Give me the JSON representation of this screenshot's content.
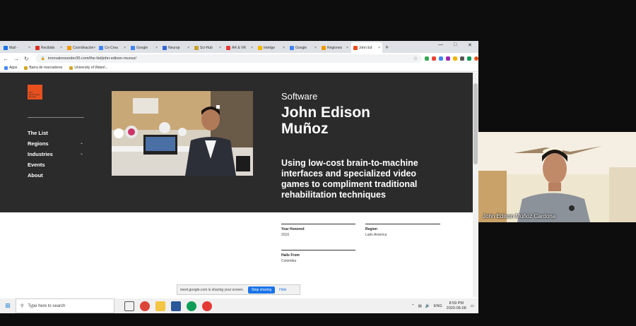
{
  "browser": {
    "tabs": [
      {
        "label": "Mail -",
        "color": "#1a73e8"
      },
      {
        "label": "Recibido",
        "color": "#d93025"
      },
      {
        "label": "Coordinación",
        "color": "#f29900"
      },
      {
        "label": "Co-Crea",
        "color": "#4285f4"
      },
      {
        "label": "Google",
        "color": "#4285f4"
      },
      {
        "label": "Neurop",
        "color": "#3367d6"
      },
      {
        "label": "Sci-Hub",
        "color": "#c8a22c"
      },
      {
        "label": "AR & VR",
        "color": "#e53935"
      },
      {
        "label": "Intelige",
        "color": "#f4b400"
      },
      {
        "label": "Google",
        "color": "#4285f4"
      },
      {
        "label": "Regiones",
        "color": "#f29900"
      },
      {
        "label": "John Ed",
        "color": "#e8501f"
      }
    ],
    "url": "innovatorsunder35.com/the-list/john-edison-munoz/",
    "bookmarks": [
      "Apps",
      "Barra de marcadores",
      "University of Waterl..."
    ]
  },
  "site": {
    "logo_text": "MIT Technology Review",
    "nav": [
      {
        "label": "The List"
      },
      {
        "label": "Regions",
        "has_dropdown": true
      },
      {
        "label": "Industries",
        "has_dropdown": true
      },
      {
        "label": "Events"
      },
      {
        "label": "About"
      }
    ],
    "category": "Software",
    "name_line1": "John Edison",
    "name_line2": "Muñoz",
    "tagline": "Using low-cost brain-to-machine interfaces and specialized video games to compliment traditional rehabilitation techniques",
    "meta": {
      "year_label": "Year Honored",
      "year_value": "2016",
      "region_label": "Region",
      "region_value": "Latin America",
      "hails_label": "Hails From",
      "hails_value": "Colombia"
    }
  },
  "share_bar": {
    "text": "meet.google.com is sharing your screen.",
    "stop_label": "Stop sharing",
    "hide_label": "Hide"
  },
  "taskbar": {
    "search_placeholder": "Type here to search",
    "lang": "ENG",
    "time": "8:59 PM",
    "date": "2020-06-08"
  },
  "webcam": {
    "participant_name": "John Edison Muñoz Cardona"
  }
}
